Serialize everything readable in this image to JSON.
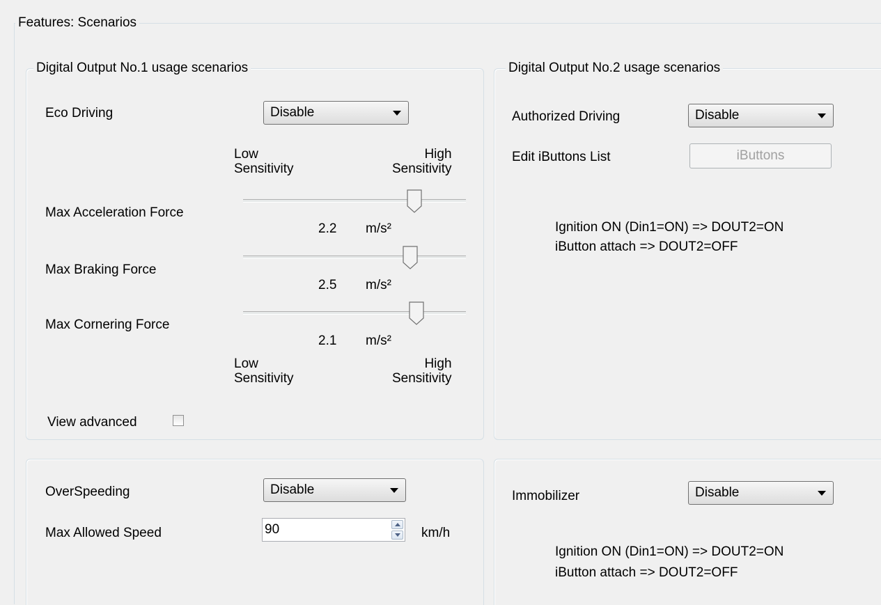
{
  "window": {
    "title": "Features: Scenarios"
  },
  "dout1": {
    "legend": "Digital Output No.1 usage scenarios",
    "eco_driving": {
      "label": "Eco Driving",
      "value": "Disable"
    },
    "sensitivity_top": {
      "low": "Low\nSensitivity",
      "high": "High\nSensitivity"
    },
    "sensitivity_bottom": {
      "low": "Low\nSensitivity",
      "high": "High\nSensitivity"
    },
    "sliders": [
      {
        "label": "Max Acceleration Force",
        "value": "2.2",
        "unit": "m/s²",
        "position": 0.79
      },
      {
        "label": "Max Braking Force",
        "value": "2.5",
        "unit": "m/s²",
        "position": 0.77
      },
      {
        "label": "Max Cornering Force",
        "value": "2.1",
        "unit": "m/s²",
        "position": 0.8
      }
    ],
    "view_advanced": {
      "label": "View advanced",
      "checked": false
    }
  },
  "dout2": {
    "legend": "Digital Output No.2 usage scenarios",
    "authorized_driving": {
      "label": "Authorized Driving",
      "value": "Disable"
    },
    "ibuttons": {
      "label": "Edit iButtons List",
      "button": "iButtons"
    },
    "info_line1": "Ignition ON (Din1=ON) => DOUT2=ON",
    "info_line2": "iButton attach => DOUT2=OFF"
  },
  "overspeed": {
    "label": "OverSpeeding",
    "value": "Disable",
    "max_speed_label": "Max Allowed Speed",
    "max_speed_value": "90",
    "unit": "km/h"
  },
  "immobilizer": {
    "label": "Immobilizer",
    "value": "Disable",
    "info_line1": "Ignition ON (Din1=ON) => DOUT2=ON",
    "info_line2": "iButton attach => DOUT2=OFF"
  }
}
